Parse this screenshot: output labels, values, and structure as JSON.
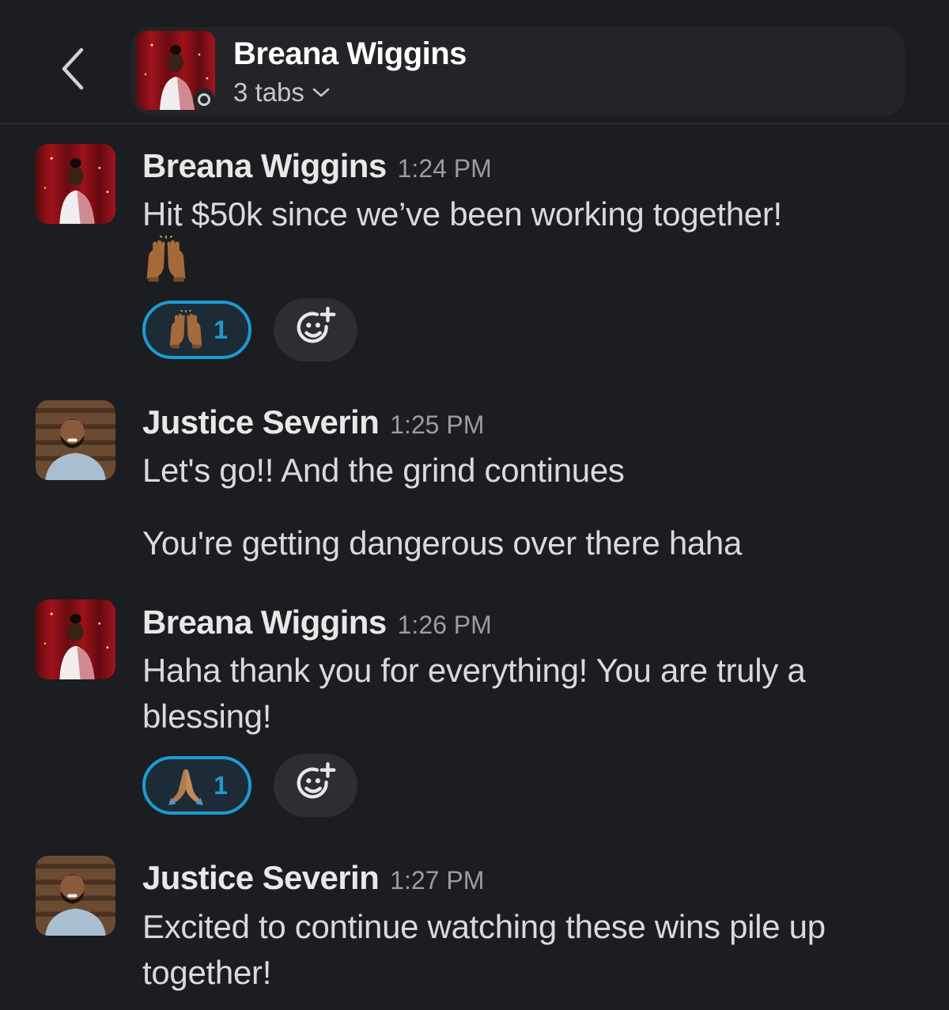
{
  "header": {
    "title": "Breana Wiggins",
    "subtitle": "3 tabs"
  },
  "messages": [
    {
      "sender": "Breana Wiggins",
      "time": "1:24 PM",
      "lines": [
        "Hit $50k since we’ve been working together!"
      ],
      "emoji_line": "raising-hands-emoji",
      "reaction": {
        "emoji": "raising-hands-emoji",
        "count": "1"
      }
    },
    {
      "sender": "Justice Severin",
      "time": "1:25 PM",
      "lines": [
        "Let's go!! And the grind continues",
        "You're getting dangerous over there haha"
      ]
    },
    {
      "sender": "Breana Wiggins",
      "time": "1:26 PM",
      "lines": [
        "Haha thank you for everything! You are truly a blessing!"
      ],
      "reaction": {
        "emoji": "folded-hands-emoji",
        "count": "1"
      }
    },
    {
      "sender": "Justice Severin",
      "time": "1:27 PM",
      "lines": [
        "Excited to continue watching these wins pile up together!"
      ]
    }
  ],
  "colors": {
    "background": "#1b1d21",
    "reaction_border": "#1d9bd1",
    "header_pill": "#222428"
  }
}
